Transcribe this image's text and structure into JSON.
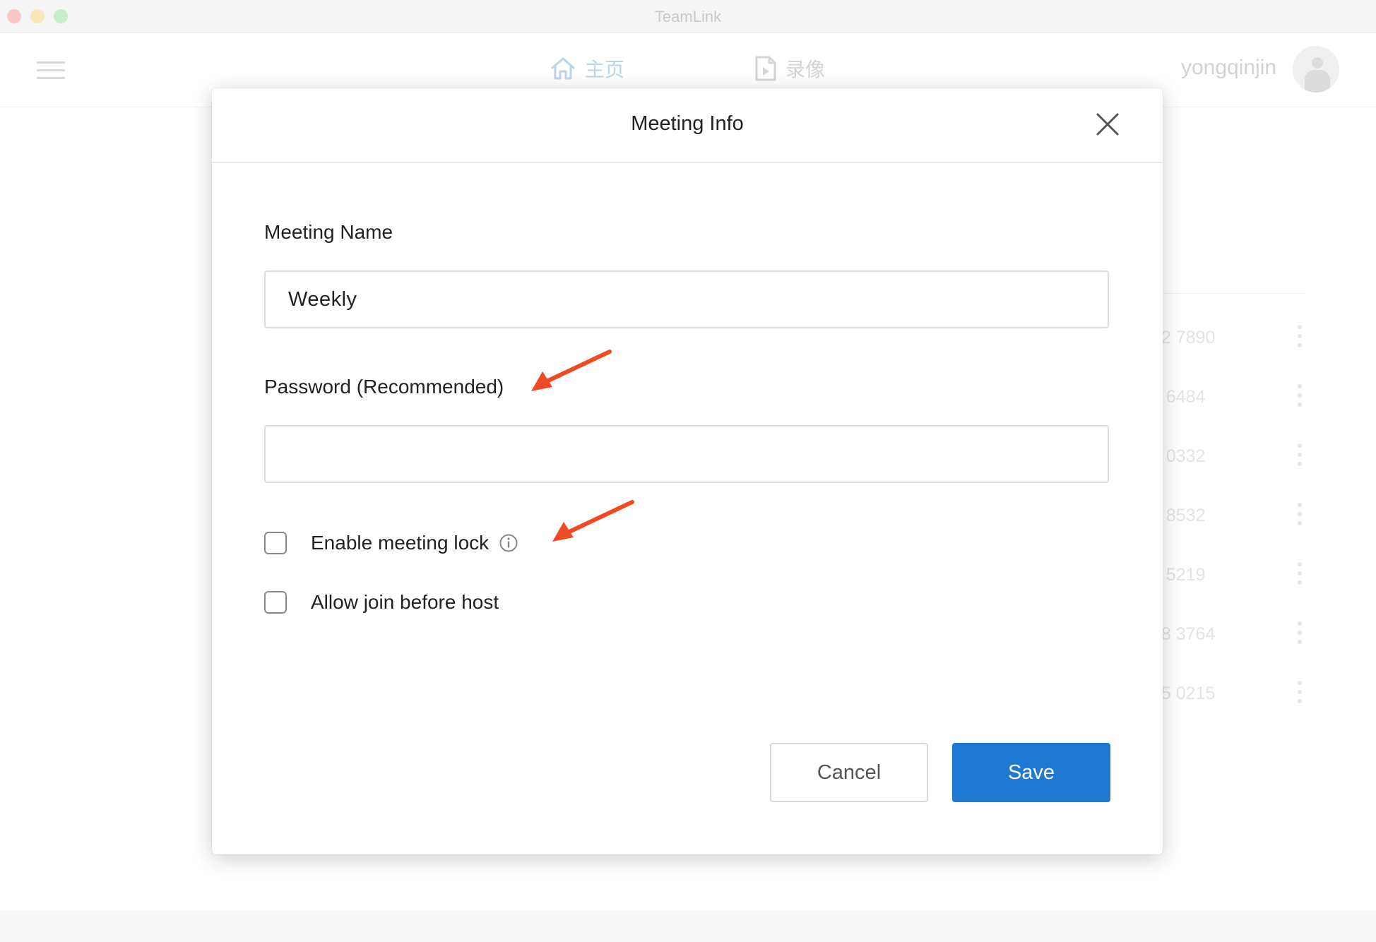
{
  "window": {
    "title": "TeamLink"
  },
  "header": {
    "nav": [
      {
        "label": "主页",
        "icon": "home-icon"
      },
      {
        "label": "录像",
        "icon": "video-file-icon"
      }
    ],
    "username": "yongqinjin"
  },
  "background_list": {
    "rows": [
      {
        "number": "32 7890"
      },
      {
        "number": "4 6484"
      },
      {
        "number": "8 0332"
      },
      {
        "number": "9 8532"
      },
      {
        "number": "1 5219"
      },
      {
        "number": "78 3764"
      },
      {
        "number": "55 0215"
      }
    ]
  },
  "dialog": {
    "title": "Meeting Info",
    "meeting_name": {
      "label": "Meeting Name",
      "value": "Weekly"
    },
    "password": {
      "label": "Password (Recommended)",
      "value": ""
    },
    "options": [
      {
        "label": "Enable meeting lock",
        "checked": false,
        "info": true
      },
      {
        "label": "Allow join before host",
        "checked": false,
        "info": false
      }
    ],
    "buttons": {
      "cancel": "Cancel",
      "save": "Save"
    }
  },
  "colors": {
    "primary": "#1f78d1",
    "annotation_arrow": "#f04a22",
    "nav_active": "#b9d4ef"
  }
}
